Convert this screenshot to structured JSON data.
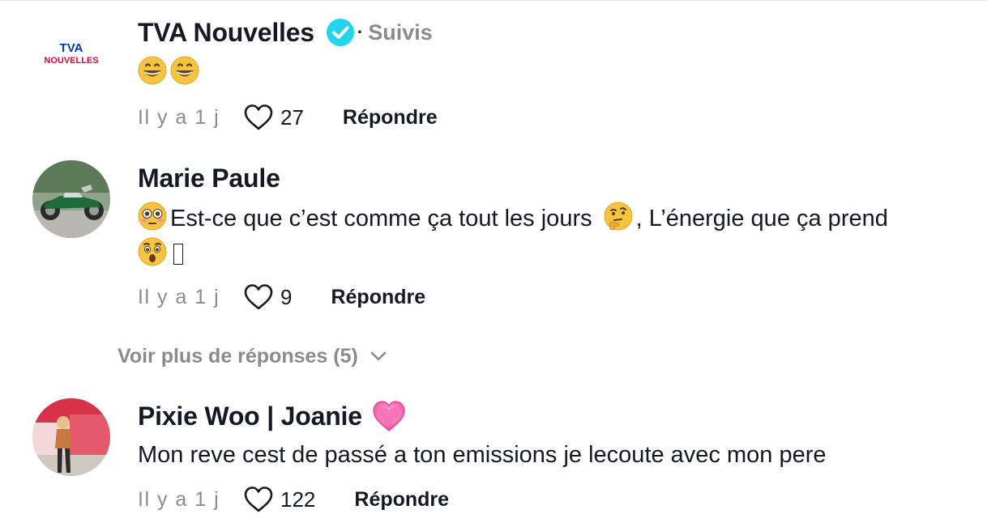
{
  "comments": [
    {
      "author": "TVA Nouvelles",
      "verified": true,
      "follow_label": "Suivis",
      "text": "",
      "emojis": [
        "grinning-face",
        "grinning-face"
      ],
      "time": "Il y a 1 j",
      "likes": "27",
      "reply_label": "Répondre",
      "avatar_logo_top": "TVA",
      "avatar_logo_bottom": "NOUVELLES"
    },
    {
      "author": "Marie Paule",
      "text": "Est-ce que c’est comme ça tout les jours",
      "text2": ", L’énergie que ça prend",
      "emojis": [
        "flushed-face",
        "thinking-face",
        "astonished-face"
      ],
      "time": "Il y a 1 j",
      "likes": "9",
      "reply_label": "Répondre"
    },
    {
      "author": "Pixie Woo | Joanie",
      "badge": "pink-heart",
      "text": "Mon reve cest de passé a ton emissions je lecoute avec mon pere",
      "time": "Il y a 1 j",
      "likes": "122",
      "reply_label": "Répondre"
    }
  ],
  "more_replies": "Voir plus de réponses (5)",
  "colors": {
    "text": "#161823",
    "muted": "#8a8b91",
    "verified": "#20d5ec",
    "tva_red": "#e4003a",
    "tva_blue": "#003da5"
  }
}
